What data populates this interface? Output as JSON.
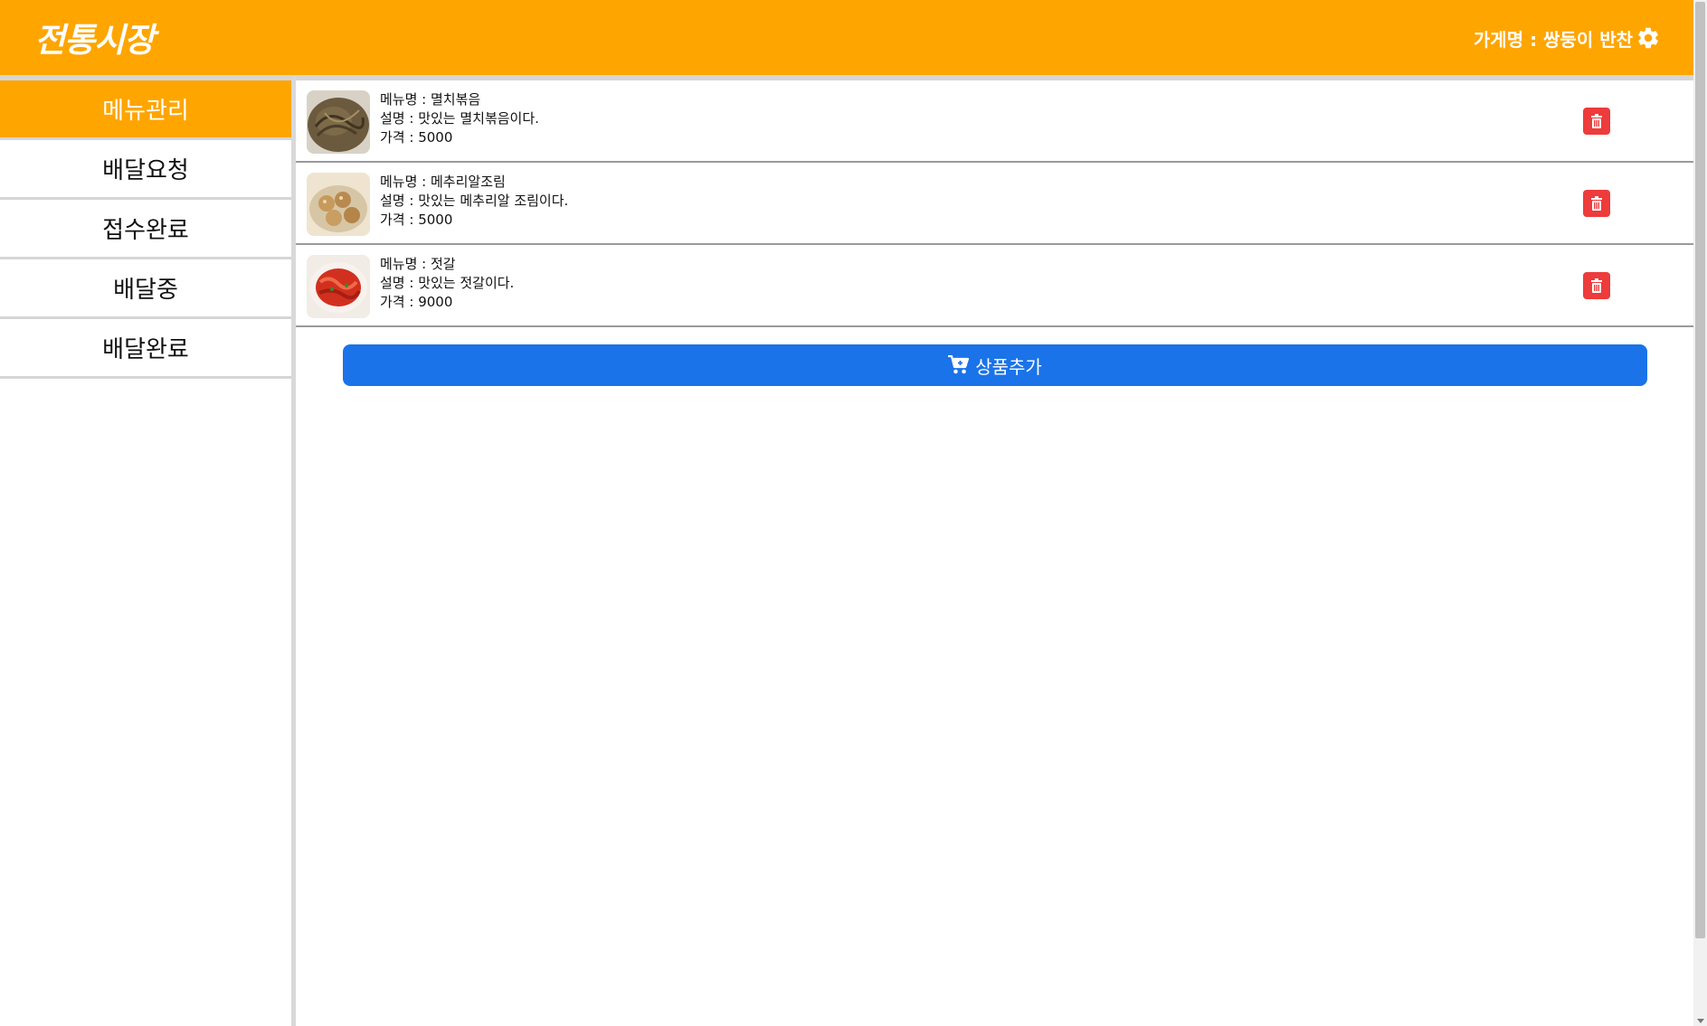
{
  "header": {
    "logo": "전통시장",
    "store_label": "가게명 : 쌍둥이 반찬",
    "settings_icon": "gear-icon"
  },
  "sidebar": {
    "items": [
      {
        "label": "메뉴관리",
        "active": true
      },
      {
        "label": "배달요청",
        "active": false
      },
      {
        "label": "접수완료",
        "active": false
      },
      {
        "label": "배달중",
        "active": false
      },
      {
        "label": "배달완료",
        "active": false
      }
    ]
  },
  "menu": {
    "items": [
      {
        "name": "메뉴명 : 멸치볶음",
        "desc": "설명 : 맛있는 멸치볶음이다.",
        "price": "가격 : 5000"
      },
      {
        "name": "메뉴명 : 메추리알조림",
        "desc": "설명 : 맛있는 메추리알 조림이다.",
        "price": "가격 : 5000"
      },
      {
        "name": "메뉴명 : 젓갈",
        "desc": "설명 : 맛있는 젓갈이다.",
        "price": "가격 : 9000"
      }
    ],
    "add_button": "상품추가"
  },
  "colors": {
    "header": "#ffa500",
    "active_nav": "#ffa500",
    "delete": "#ee3b3b",
    "primary": "#1a73e8"
  }
}
